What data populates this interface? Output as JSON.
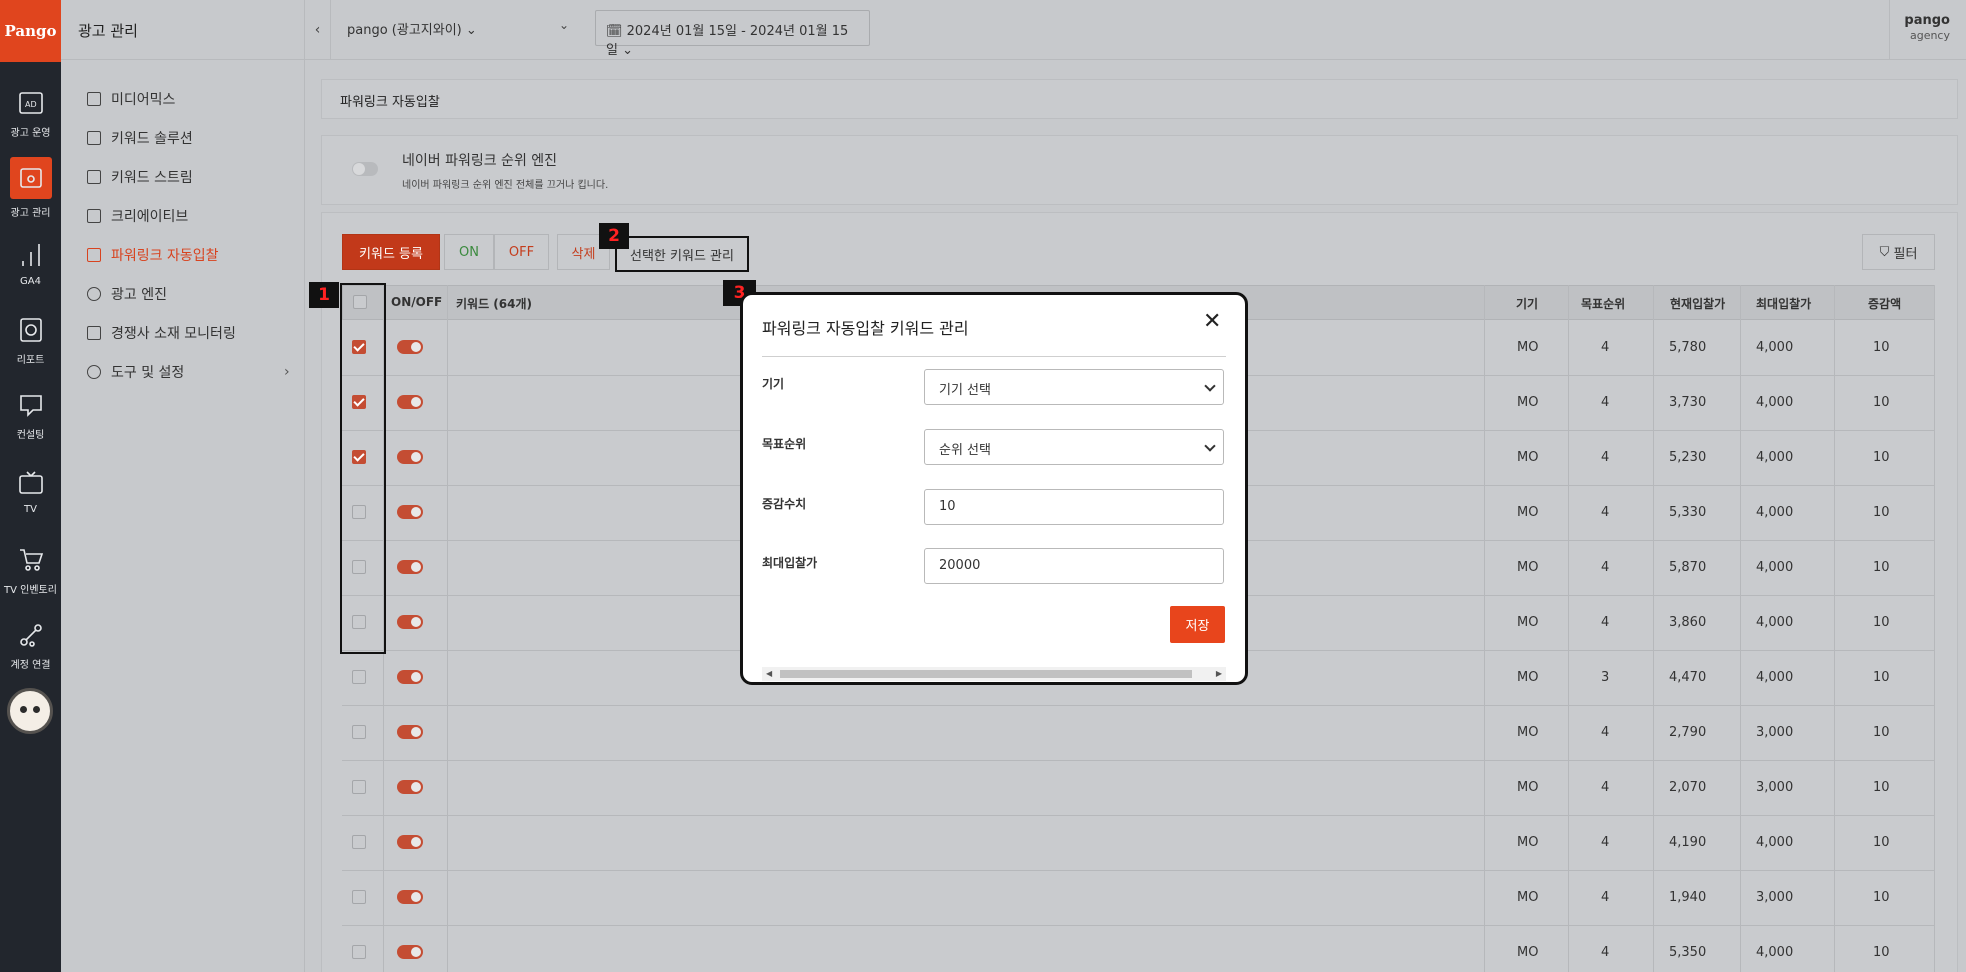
{
  "rail": {
    "logo": "Pango",
    "items": [
      {
        "label": "광고 운영",
        "icon": "ad-icon"
      },
      {
        "label": "광고 관리",
        "icon": "ad-settings-icon"
      },
      {
        "label": "GA4",
        "icon": "analytics-icon"
      },
      {
        "label": "리포트",
        "icon": "report-icon"
      },
      {
        "label": "컨설팅",
        "icon": "consulting-icon"
      },
      {
        "label": "TV",
        "icon": "tv-icon"
      },
      {
        "label": "TV 인벤토리",
        "icon": "cart-icon"
      },
      {
        "label": "계정 연결",
        "icon": "share-icon"
      }
    ]
  },
  "side": {
    "title": "광고 관리",
    "items": [
      {
        "label": "미디어믹스"
      },
      {
        "label": "키워드 솔루션"
      },
      {
        "label": "키워드 스트림"
      },
      {
        "label": "크리에이티브"
      },
      {
        "label": "파워링크 자동입찰"
      },
      {
        "label": "광고 엔진"
      },
      {
        "label": "경쟁사 소재 모니터링"
      },
      {
        "label": "도구 및 설정"
      }
    ]
  },
  "top": {
    "account": "pango (광고지와이) ⌄",
    "date_range": "🗓 2024년 01월 15일 - 2024년 01월 15일 ⌄",
    "brand_name": "pango",
    "brand_sub": "agency"
  },
  "page_title": "파워링크 자동입찰",
  "engine": {
    "title": "네이버 파워링크 순위 엔진",
    "desc": "네이버 파워링크 순위 엔진 전체를 끄거나 킵니다."
  },
  "toolbar": {
    "register": "키워드 등록",
    "on": "ON",
    "off": "OFF",
    "delete": "삭제",
    "manage_selected": "선택한 키워드 관리",
    "filter": "필터"
  },
  "callouts": [
    "1",
    "2",
    "3"
  ],
  "table": {
    "headers": {
      "onoff": "ON/OFF",
      "keyword": "키워드 (64개)",
      "device": "기기",
      "target_rank": "목표순위",
      "current_bid": "현재입찰가",
      "max_bid": "최대입찰가",
      "increment": "증감액"
    },
    "rows": [
      {
        "checked": true,
        "device": "MO",
        "target_rank": "4",
        "current_bid": "5,780",
        "max_bid": "4,000",
        "increment": "10"
      },
      {
        "checked": true,
        "device": "MO",
        "target_rank": "4",
        "current_bid": "3,730",
        "max_bid": "4,000",
        "increment": "10"
      },
      {
        "checked": true,
        "device": "MO",
        "target_rank": "4",
        "current_bid": "5,230",
        "max_bid": "4,000",
        "increment": "10"
      },
      {
        "checked": false,
        "device": "MO",
        "target_rank": "4",
        "current_bid": "5,330",
        "max_bid": "4,000",
        "increment": "10"
      },
      {
        "checked": false,
        "device": "MO",
        "target_rank": "4",
        "current_bid": "5,870",
        "max_bid": "4,000",
        "increment": "10"
      },
      {
        "checked": false,
        "device": "MO",
        "target_rank": "4",
        "current_bid": "3,860",
        "max_bid": "4,000",
        "increment": "10"
      },
      {
        "checked": false,
        "device": "MO",
        "target_rank": "3",
        "current_bid": "4,470",
        "max_bid": "4,000",
        "increment": "10"
      },
      {
        "checked": false,
        "device": "MO",
        "target_rank": "4",
        "current_bid": "2,790",
        "max_bid": "3,000",
        "increment": "10"
      },
      {
        "checked": false,
        "device": "MO",
        "target_rank": "4",
        "current_bid": "2,070",
        "max_bid": "3,000",
        "increment": "10"
      },
      {
        "checked": false,
        "device": "MO",
        "target_rank": "4",
        "current_bid": "4,190",
        "max_bid": "4,000",
        "increment": "10"
      },
      {
        "checked": false,
        "device": "MO",
        "target_rank": "4",
        "current_bid": "1,940",
        "max_bid": "3,000",
        "increment": "10"
      },
      {
        "checked": false,
        "device": "MO",
        "target_rank": "4",
        "current_bid": "5,350",
        "max_bid": "4,000",
        "increment": "10"
      }
    ]
  },
  "modal": {
    "title": "파워링크 자동입찰 키워드 관리",
    "device_label": "기기",
    "device_value": "기기 선택",
    "rank_label": "목표순위",
    "rank_value": "순위 선택",
    "increment_label": "증감수치",
    "increment_value": "10",
    "max_bid_label": "최대입찰가",
    "max_bid_value": "20000",
    "save": "저장"
  }
}
